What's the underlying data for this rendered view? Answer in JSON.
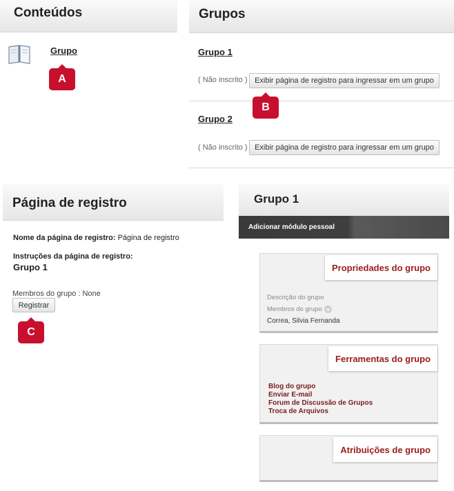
{
  "conteudos": {
    "title": "Conteúdos",
    "item_link": "Grupo",
    "callout": "A"
  },
  "grupos": {
    "title": "Grupos",
    "groups": [
      {
        "name": "Grupo 1",
        "status": "( Não inscrito )",
        "button": "Exibir página de registro para ingressar em um grupo"
      },
      {
        "name": "Grupo 2",
        "status": "( Não inscrito )",
        "button": "Exibir página de registro para ingressar em um grupo"
      }
    ],
    "callout": "B"
  },
  "registro": {
    "title": "Página de registro",
    "name_label": "Nome da página de registro:",
    "name_value": "Página de registro",
    "instructions_label": "Instruções da página de registro:",
    "instructions_value": "Grupo 1",
    "members_text": "Membros do grupo : None",
    "register_button": "Registrar",
    "callout": "C"
  },
  "grupo1": {
    "title": "Grupo 1",
    "add_module": "Adicionar módulo pessoal",
    "propriedades": {
      "title": "Propriedades do grupo",
      "descricao_label": "Descrição do grupo",
      "membros_label": "Membros do grupo",
      "member": "Correa, Silvia Fernanda"
    },
    "ferramentas": {
      "title": "Ferramentas do grupo",
      "links": [
        "Blog do grupo",
        "Enviar E-mail",
        "Forum de Discussão de Grupos",
        "Troca de Arquivos"
      ]
    },
    "atribuicoes": {
      "title": "Atribuições de grupo"
    }
  },
  "colors": {
    "callout": "#c8102e",
    "card_title": "#9b1b1b",
    "tool_link": "#7a1c1c",
    "dark_bar": "#3a3a3a"
  }
}
